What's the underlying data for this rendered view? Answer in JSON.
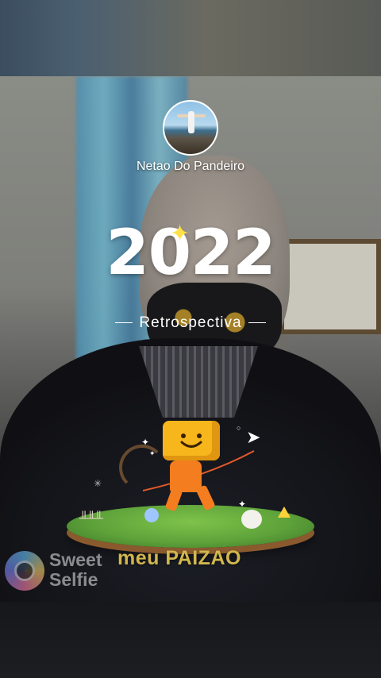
{
  "profile": {
    "username": "Netao Do Pandeiro",
    "avatar_icon": "profile-photo"
  },
  "title": {
    "year": "2022",
    "subtitle": "Retrospectiva",
    "sparkle_color": "#ffe14a"
  },
  "illustration": {
    "icons": [
      "cube-character",
      "paper-plane-icon",
      "grass-island",
      "duck-icon",
      "flower-icon"
    ]
  },
  "watermark": {
    "app_name_line1": "Sweet",
    "app_name_line2": "Selfie",
    "caption": "meu PAIZAO"
  }
}
